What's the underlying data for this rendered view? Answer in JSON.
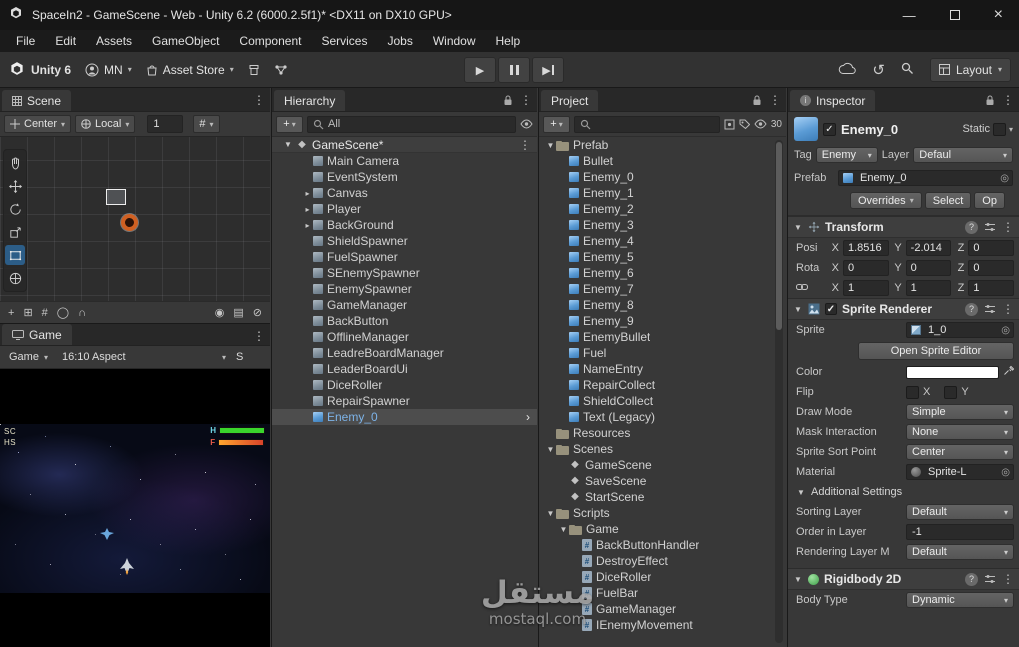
{
  "window": {
    "title": "SpaceIn2 - GameScene - Web - Unity 6.2 (6000.2.5f1)* <DX11 on DX10 GPU>"
  },
  "menu": {
    "items": [
      "File",
      "Edit",
      "Assets",
      "GameObject",
      "Component",
      "Services",
      "Jobs",
      "Window",
      "Help"
    ]
  },
  "toolbar": {
    "unity_version": "Unity 6",
    "account_initials": "MN",
    "asset_store_label": "Asset Store",
    "layout_label": "Layout"
  },
  "scene_panel": {
    "tab_label": "Scene",
    "pivot_label": "Center",
    "orientation_label": "Local",
    "grid_size_value": "1",
    "footer_tools": [
      {
        "name": "move-gizmo-icon",
        "glyph": "+"
      },
      {
        "name": "pivot-center-icon",
        "glyph": "⊞"
      },
      {
        "name": "grid-snap-icon",
        "glyph": "#"
      },
      {
        "name": "sphere-gizmo-icon",
        "glyph": "◯"
      },
      {
        "name": "snap-magnet-icon",
        "glyph": "∩"
      },
      {
        "name": "search-icon",
        "glyph": "◉"
      },
      {
        "name": "layers-icon",
        "glyph": "▤"
      },
      {
        "name": "gizmos-toggle-icon",
        "glyph": "⊘"
      }
    ]
  },
  "game_panel": {
    "tab_label": "Game",
    "display_label": "Game",
    "aspect_label": "16:10 Aspect",
    "scale_label": "S",
    "hud": {
      "score_label": "SC",
      "highscore_label": "HS",
      "health_label": "H",
      "fuel_label": "F"
    }
  },
  "hierarchy": {
    "tab_label": "Hierarchy",
    "search_scope": "All",
    "scene_name": "GameScene*",
    "items": [
      {
        "label": "Main Camera"
      },
      {
        "label": "EventSystem"
      },
      {
        "label": "Canvas",
        "expand": true
      },
      {
        "label": "Player",
        "expand": true
      },
      {
        "label": "BackGround",
        "expand": true
      },
      {
        "label": "ShieldSpawner"
      },
      {
        "label": "FuelSpawner"
      },
      {
        "label": "SEnemySpawner"
      },
      {
        "label": "EnemySpawner"
      },
      {
        "label": "GameManager"
      },
      {
        "label": "BackButton"
      },
      {
        "label": "OfflineManager"
      },
      {
        "label": "LeadreBoardManager"
      },
      {
        "label": "LeaderBoardUi"
      },
      {
        "label": "DiceRoller"
      },
      {
        "label": "RepairSpawner"
      },
      {
        "label": "Enemy_0",
        "selected": true,
        "prefab": true,
        "nav": true
      }
    ]
  },
  "project": {
    "tab_label": "Project",
    "hidden_count": "30",
    "items": [
      {
        "label": "Prefab",
        "type": "folder",
        "depth": 0,
        "open": true
      },
      {
        "label": "Bullet",
        "type": "prefab",
        "depth": 1
      },
      {
        "label": "Enemy_0",
        "type": "prefab",
        "depth": 1
      },
      {
        "label": "Enemy_1",
        "type": "prefab",
        "depth": 1
      },
      {
        "label": "Enemy_2",
        "type": "prefab",
        "depth": 1
      },
      {
        "label": "Enemy_3",
        "type": "prefab",
        "depth": 1
      },
      {
        "label": "Enemy_4",
        "type": "prefab",
        "depth": 1
      },
      {
        "label": "Enemy_5",
        "type": "prefab",
        "depth": 1
      },
      {
        "label": "Enemy_6",
        "type": "prefab",
        "depth": 1
      },
      {
        "label": "Enemy_7",
        "type": "prefab",
        "depth": 1
      },
      {
        "label": "Enemy_8",
        "type": "prefab",
        "depth": 1
      },
      {
        "label": "Enemy_9",
        "type": "prefab",
        "depth": 1
      },
      {
        "label": "EnemyBullet",
        "type": "prefab",
        "depth": 1
      },
      {
        "label": "Fuel",
        "type": "prefab",
        "depth": 1
      },
      {
        "label": "NameEntry",
        "type": "prefab",
        "depth": 1
      },
      {
        "label": "RepairCollect",
        "type": "prefab",
        "depth": 1
      },
      {
        "label": "ShieldCollect",
        "type": "prefab",
        "depth": 1
      },
      {
        "label": "Text (Legacy)",
        "type": "prefab",
        "depth": 1
      },
      {
        "label": "Resources",
        "type": "folder",
        "depth": 0
      },
      {
        "label": "Scenes",
        "type": "folder",
        "depth": 0,
        "open": true
      },
      {
        "label": "GameScene",
        "type": "scene",
        "depth": 1
      },
      {
        "label": "SaveScene",
        "type": "scene",
        "depth": 1
      },
      {
        "label": "StartScene",
        "type": "scene",
        "depth": 1
      },
      {
        "label": "Scripts",
        "type": "folder",
        "depth": 0,
        "open": true
      },
      {
        "label": "Game",
        "type": "folder",
        "depth": 1,
        "open": true
      },
      {
        "label": "BackButtonHandler",
        "type": "script",
        "depth": 2
      },
      {
        "label": "DestroyEffect",
        "type": "script",
        "depth": 2
      },
      {
        "label": "DiceRoller",
        "type": "script",
        "depth": 2
      },
      {
        "label": "FuelBar",
        "type": "script",
        "depth": 2
      },
      {
        "label": "GameManager",
        "type": "script",
        "depth": 2
      },
      {
        "label": "IEnemyMovement",
        "type": "script",
        "depth": 2
      }
    ]
  },
  "inspector": {
    "tab_label": "Inspector",
    "object_name": "Enemy_0",
    "static_label": "Static",
    "tag_label": "Tag",
    "tag_value": "Enemy",
    "layer_label": "Layer",
    "layer_value": "Defaul",
    "prefab_label": "Prefab",
    "prefab_value": "Enemy_0",
    "overrides_label": "Overrides",
    "select_label": "Select",
    "open_label": "Op",
    "transform": {
      "title": "Transform",
      "axis": [
        "X",
        "Y",
        "Z"
      ],
      "rows": [
        {
          "label": "Posi",
          "x": "1.8516",
          "y": "-2.014",
          "z": "0"
        },
        {
          "label": "Rota",
          "x": "0",
          "y": "0",
          "z": "0"
        },
        {
          "label": "",
          "link": true,
          "x": "1",
          "y": "1",
          "z": "1"
        }
      ]
    },
    "sprite_renderer": {
      "title": "Sprite Renderer",
      "sprite_label": "Sprite",
      "sprite_value": "1_0",
      "open_sprite_editor": "Open Sprite Editor",
      "color_label": "Color",
      "flip_label": "Flip",
      "flip_x": "X",
      "flip_y": "Y",
      "rows": [
        {
          "label": "Draw Mode",
          "value": "Simple",
          "type": "dropdown"
        },
        {
          "label": "Mask Interaction",
          "value": "None",
          "type": "dropdown"
        },
        {
          "label": "Sprite Sort Point",
          "value": "Center",
          "type": "dropdown"
        },
        {
          "label": "Material",
          "value": "Sprite-L",
          "type": "object"
        }
      ],
      "additional_settings": "Additional Settings",
      "adv_rows": [
        {
          "label": "Sorting Layer",
          "value": "Default",
          "type": "dropdown"
        },
        {
          "label": "Order in Layer",
          "value": "-1",
          "type": "input"
        },
        {
          "label": "Rendering Layer M",
          "value": "Default",
          "type": "dropdown"
        }
      ]
    },
    "rigidbody": {
      "title": "Rigidbody 2D",
      "body_type_label": "Body Type",
      "body_type_value": "Dynamic"
    }
  },
  "watermark": {
    "title": "مستقل",
    "subtitle": "mostaql.com"
  },
  "icons": {
    "kebab": "⋮",
    "dropdown_arrow": "▾",
    "foldout_open": "▼",
    "expand_closed": "▸",
    "plus": "+",
    "picker": "◎",
    "history": "↺",
    "play": "▶",
    "nav_arrow": "›",
    "check": "✓",
    "minimize": "—",
    "close": "×",
    "help": "?"
  },
  "colors": {
    "titlebar": "#161616",
    "menubar": "#1b1b1b",
    "toolbar": "#323232",
    "tabbar": "#282828",
    "panel": "#383838",
    "field": "#2a2a2a",
    "button": "#585858",
    "selected_row": "#4d4d4d",
    "text": "#d4d4d4",
    "prefab_blue": "#7db3e8",
    "health_green": "#3ad52c",
    "scene_bg": "#2d2d2d"
  }
}
